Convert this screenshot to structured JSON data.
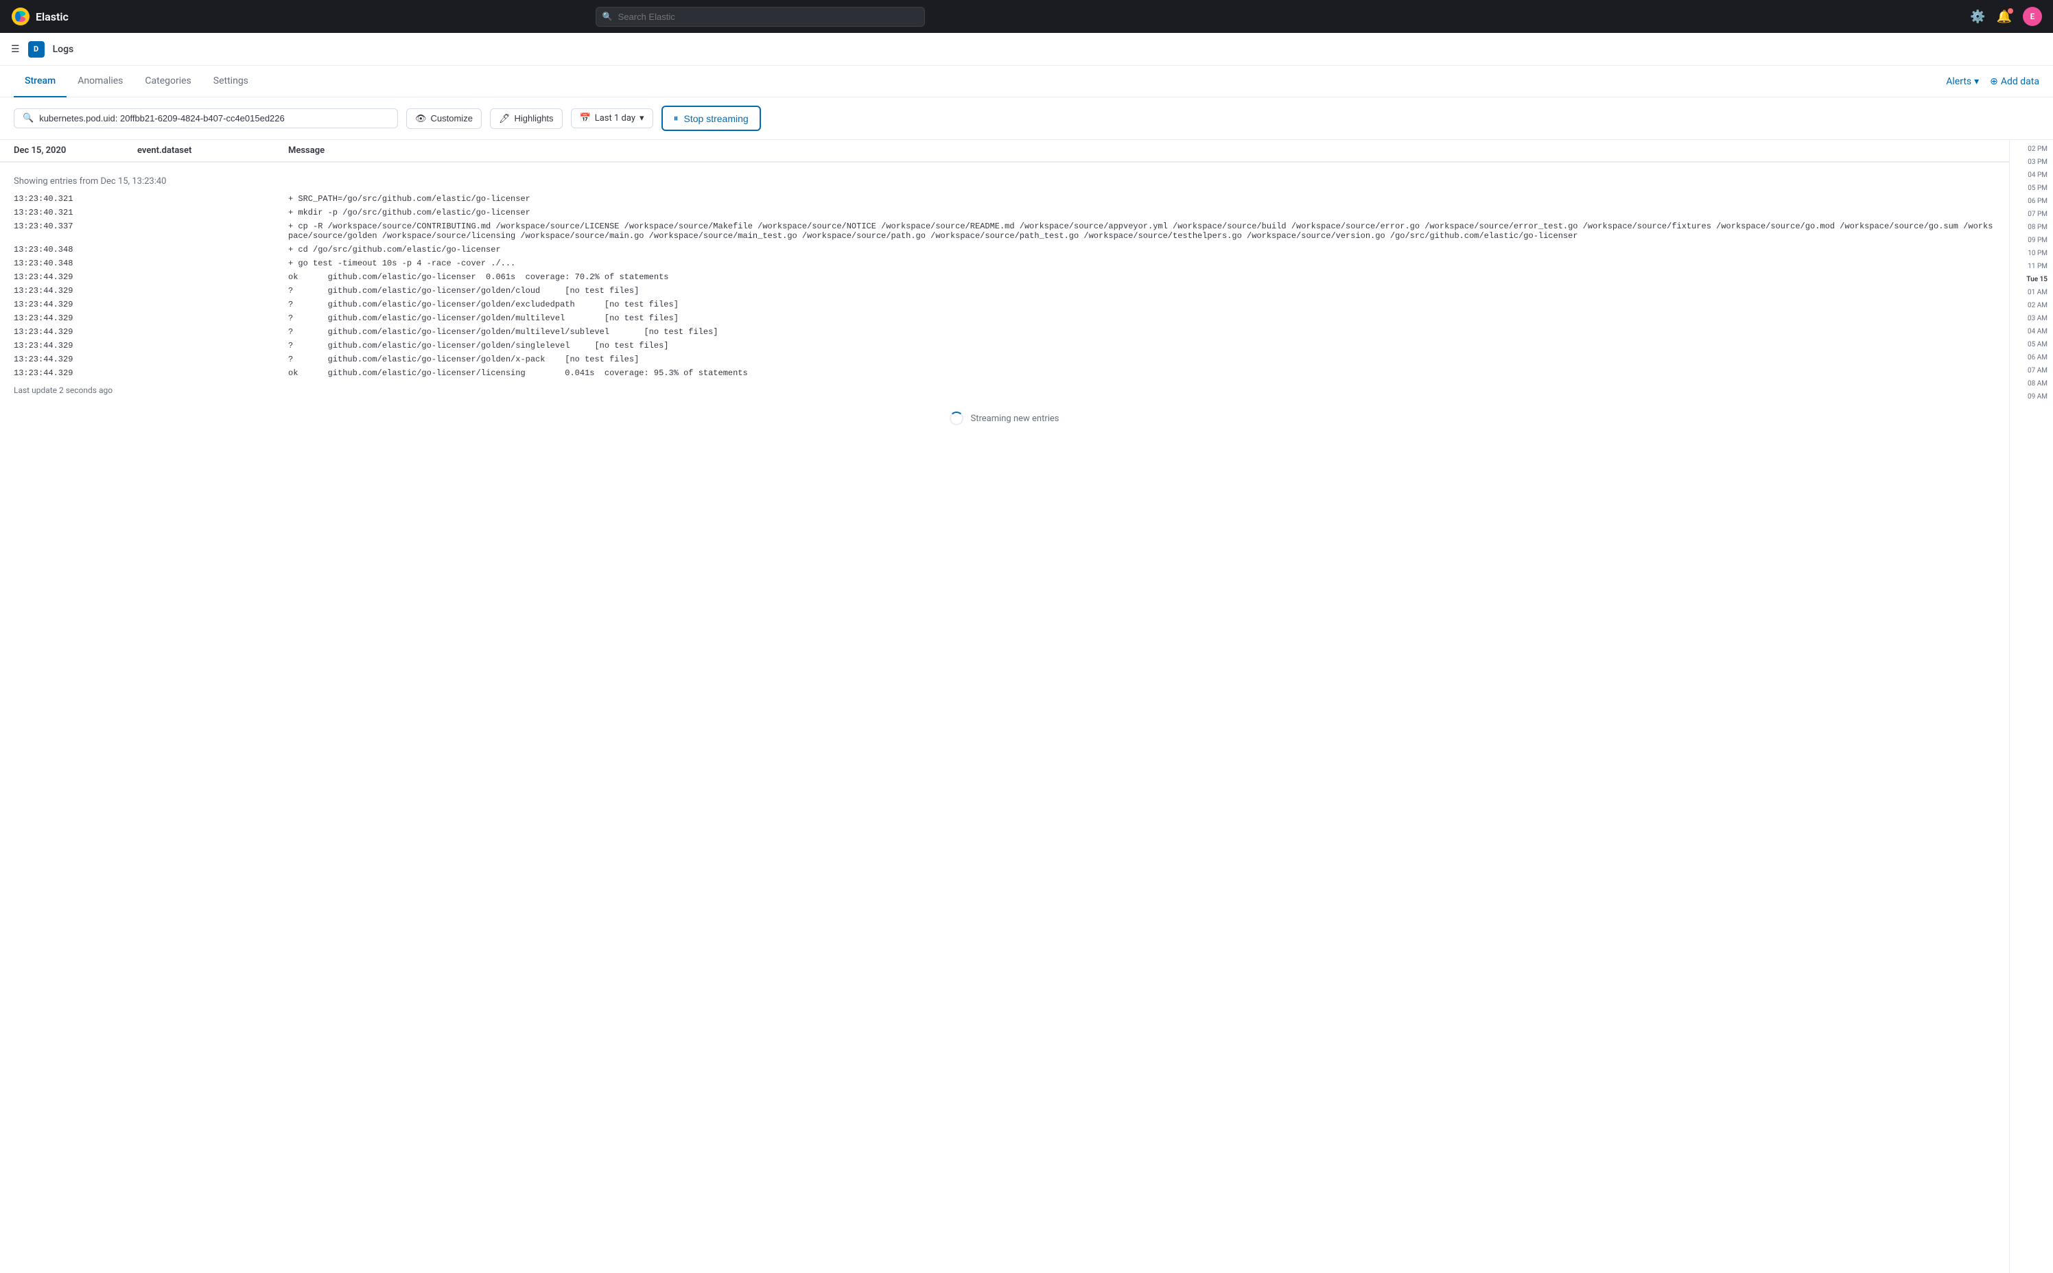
{
  "app": {
    "name": "Elastic",
    "logo_char": "E"
  },
  "topnav": {
    "search_placeholder": "Search Elastic",
    "avatar_char": "E"
  },
  "subnav": {
    "breadcrumb_char": "D",
    "title": "Logs"
  },
  "tabs": [
    {
      "id": "stream",
      "label": "Stream",
      "active": true
    },
    {
      "id": "anomalies",
      "label": "Anomalies",
      "active": false
    },
    {
      "id": "categories",
      "label": "Categories",
      "active": false
    },
    {
      "id": "settings",
      "label": "Settings",
      "active": false
    }
  ],
  "tabs_right": {
    "alerts_label": "Alerts",
    "add_data_label": "Add data"
  },
  "toolbar": {
    "filter_value": "kubernetes.pod.uid: 20ffbb21-6209-4824-b407-cc4e015ed226",
    "customize_label": "Customize",
    "highlights_label": "Highlights",
    "date_label": "Last 1 day",
    "stop_streaming_label": "Stop streaming"
  },
  "table_headers": {
    "date": "Dec 15, 2020",
    "dataset": "event.dataset",
    "message": "Message"
  },
  "entries_info": "Showing entries from Dec 15, 13:23:40",
  "log_rows": [
    {
      "time": "13:23:40.321",
      "dataset": "",
      "message": "+ SRC_PATH=/go/src/github.com/elastic/go-licenser"
    },
    {
      "time": "13:23:40.321",
      "dataset": "",
      "message": "+ mkdir -p /go/src/github.com/elastic/go-licenser"
    },
    {
      "time": "13:23:40.337",
      "dataset": "",
      "message": "+ cp -R /workspace/source/CONTRIBUTING.md /workspace/source/LICENSE /workspace/source/Makefile /workspace/source/NOTICE /workspace/source/README.md /workspace/source/appveyor.yml /workspace/source/build /workspace/source/error.go /workspace/source/error_test.go /workspace/source/fixtures /workspace/source/go.mod /workspace/source/go.sum /workspace/source/golden /workspace/source/licensing /workspace/source/main.go /workspace/source/main_test.go /workspace/source/path.go /workspace/source/path_test.go /workspace/source/testhelpers.go /workspace/source/version.go /go/src/github.com/elastic/go-licenser"
    },
    {
      "time": "13:23:40.348",
      "dataset": "",
      "message": "+ cd /go/src/github.com/elastic/go-licenser"
    },
    {
      "time": "13:23:40.348",
      "dataset": "",
      "message": "+ go test -timeout 10s -p 4 -race -cover ./..."
    },
    {
      "time": "13:23:44.329",
      "dataset": "",
      "message": "ok      github.com/elastic/go-licenser  0.061s  coverage: 70.2% of statements"
    },
    {
      "time": "13:23:44.329",
      "dataset": "",
      "message": "?       github.com/elastic/go-licenser/golden/cloud     [no test files]"
    },
    {
      "time": "13:23:44.329",
      "dataset": "",
      "message": "?       github.com/elastic/go-licenser/golden/excludedpath      [no test files]"
    },
    {
      "time": "13:23:44.329",
      "dataset": "",
      "message": "?       github.com/elastic/go-licenser/golden/multilevel        [no test files]"
    },
    {
      "time": "13:23:44.329",
      "dataset": "",
      "message": "?       github.com/elastic/go-licenser/golden/multilevel/sublevel       [no test files]"
    },
    {
      "time": "13:23:44.329",
      "dataset": "",
      "message": "?       github.com/elastic/go-licenser/golden/singlelevel     [no test files]"
    },
    {
      "time": "13:23:44.329",
      "dataset": "",
      "message": "?       github.com/elastic/go-licenser/golden/x-pack    [no test files]"
    },
    {
      "time": "13:23:44.329",
      "dataset": "",
      "message": "ok      github.com/elastic/go-licenser/licensing        0.041s  coverage: 95.3% of statements"
    }
  ],
  "last_update": "Last update 2 seconds ago",
  "streaming_label": "Streaming new entries",
  "timeline": {
    "labels": [
      {
        "text": "02 PM",
        "highlight": false
      },
      {
        "text": "03 PM",
        "highlight": false
      },
      {
        "text": "04 PM",
        "highlight": false
      },
      {
        "text": "05 PM",
        "highlight": false
      },
      {
        "text": "06 PM",
        "highlight": false
      },
      {
        "text": "07 PM",
        "highlight": false
      },
      {
        "text": "08 PM",
        "highlight": false
      },
      {
        "text": "09 PM",
        "highlight": false
      },
      {
        "text": "10 PM",
        "highlight": false
      },
      {
        "text": "11 PM",
        "highlight": false
      },
      {
        "text": "Tue 15",
        "highlight": true
      },
      {
        "text": "01 AM",
        "highlight": false
      },
      {
        "text": "02 AM",
        "highlight": false
      },
      {
        "text": "03 AM",
        "highlight": false
      },
      {
        "text": "04 AM",
        "highlight": false
      },
      {
        "text": "05 AM",
        "highlight": false
      },
      {
        "text": "06 AM",
        "highlight": false
      },
      {
        "text": "07 AM",
        "highlight": false
      },
      {
        "text": "08 AM",
        "highlight": false
      },
      {
        "text": "09 AM",
        "highlight": false
      }
    ]
  }
}
